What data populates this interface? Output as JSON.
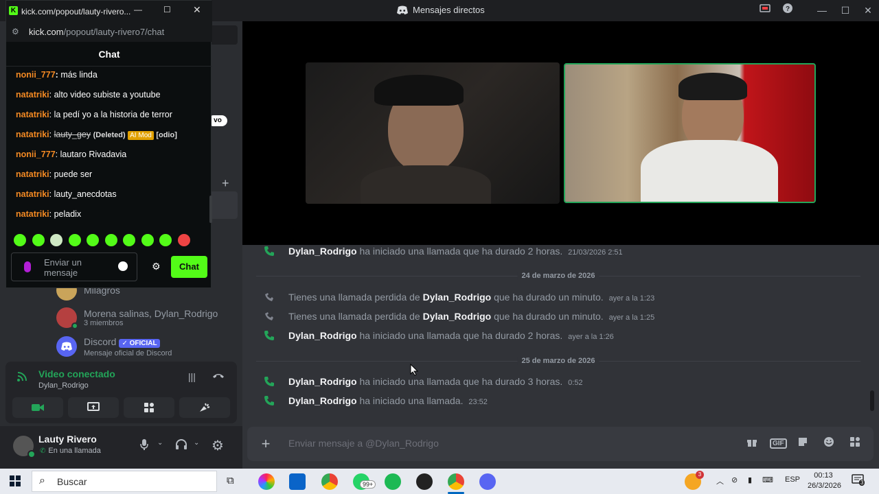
{
  "discord": {
    "window_title": "Mensajes directos",
    "dm_list": [
      {
        "name": "Milagros",
        "sub": ""
      },
      {
        "name": "Morena salinas, Dylan_Rodrigo",
        "sub": "3 miembros"
      },
      {
        "name": "Discord",
        "badge": "✓ OFICIAL",
        "sub": "Mensaje oficial de Discord"
      }
    ],
    "partial_pill": "vo",
    "voice": {
      "status": "Video conectado",
      "channel": "Dylan_Rodrigo"
    },
    "user": {
      "name": "Lauty Rivero",
      "status": "En una llamada"
    },
    "messages": [
      {
        "type": "call",
        "name": "Dylan_Rodrigo",
        "text": " ha iniciado una llamada que ha durado 2 horas.",
        "time": "21/03/2026 2:51"
      },
      {
        "type": "divider",
        "text": "24 de marzo de 2026"
      },
      {
        "type": "missed",
        "prefix": "Tienes una llamada perdida de ",
        "name": "Dylan_Rodrigo",
        "text": " que ha durado un minuto.",
        "time": "ayer a la 1:23"
      },
      {
        "type": "missed",
        "prefix": "Tienes una llamada perdida de ",
        "name": "Dylan_Rodrigo",
        "text": " que ha durado un minuto.",
        "time": "ayer a la 1:25"
      },
      {
        "type": "call",
        "name": "Dylan_Rodrigo",
        "text": " ha iniciado una llamada que ha durado 2 horas.",
        "time": "ayer a la 1:26"
      },
      {
        "type": "divider",
        "text": "25 de marzo de 2026"
      },
      {
        "type": "call",
        "name": "Dylan_Rodrigo",
        "text": " ha iniciado una llamada que ha durado 3 horas.",
        "time": "0:52"
      },
      {
        "type": "call",
        "name": "Dylan_Rodrigo",
        "text": " ha iniciado una llamada.",
        "time": "23:52"
      }
    ],
    "composer_placeholder": "Enviar mensaje a @Dylan_Rodrigo",
    "composer_gif": "GIF",
    "colors": {
      "green": "#23a559",
      "accent": "#5865f2"
    }
  },
  "kick": {
    "window_title": "kick.com/popout/lauty-rivero...",
    "url_domain": "kick.com",
    "url_path": "/popout/lauty-rivero7/chat",
    "header": "Chat",
    "chat": [
      {
        "user": "nonii_777",
        "color": "orange",
        "msg": "más linda"
      },
      {
        "user": "natatriki",
        "color": "white",
        "msg": "alto video subiste a youtube"
      },
      {
        "user": "natatriki",
        "color": "white",
        "msg": "la pedí yo a la historia de terror"
      },
      {
        "user": "natatriki",
        "color": "white",
        "msg": "lauty_gey",
        "deleted": "(Deleted)",
        "tag": "AI Mod",
        "extra": "[odio]"
      },
      {
        "user": "nonii_777",
        "color": "orange",
        "msg": "lautaro Rivadavia"
      },
      {
        "user": "natatriki",
        "color": "white",
        "msg": "puede ser"
      },
      {
        "user": "natatriki",
        "color": "white",
        "msg": "lauty_anecdotas"
      },
      {
        "user": "natatriki",
        "color": "white",
        "msg": "peladix"
      }
    ],
    "input_placeholder": "Enviar un mensaje",
    "send_label": "Chat",
    "colors": {
      "brand": "#53fc18"
    }
  },
  "taskbar": {
    "search_placeholder": "Buscar",
    "whatsapp_badge": "99+",
    "language": "ESP",
    "time": "00:13",
    "date": "26/3/2026",
    "notif_count": "3",
    "weather_badge": "3"
  }
}
